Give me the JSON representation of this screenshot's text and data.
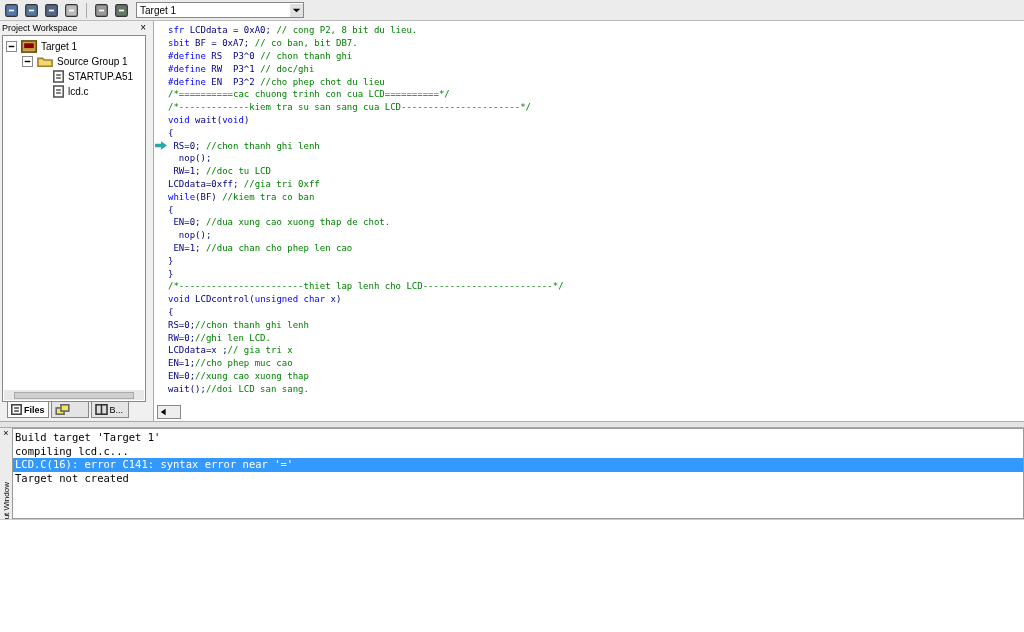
{
  "toolbar": {
    "target": "Target 1"
  },
  "workspace": {
    "title": "Project Workspace",
    "close": "×",
    "tree": [
      {
        "label": "Target 1",
        "kind": "target",
        "expanded": true,
        "children": [
          {
            "label": "Source Group 1",
            "kind": "folder",
            "expanded": true,
            "children": [
              {
                "label": "STARTUP.A51",
                "kind": "file"
              },
              {
                "label": "lcd.c",
                "kind": "file"
              }
            ]
          }
        ]
      }
    ],
    "tabs": [
      {
        "label": "Files",
        "kind": "files",
        "selected": true
      },
      {
        "kind": "regs",
        "selected": false
      },
      {
        "label": "B...",
        "kind": "books",
        "selected": false
      }
    ]
  },
  "editor": {
    "lines": [
      {
        "segs": [
          {
            "kind": "kw",
            "text": "sfr"
          },
          {
            "kind": "code",
            "text": " LCDdata = 0xA0; "
          },
          {
            "kind": "comment",
            "text": "// cong P2, 8 bit du lieu."
          }
        ]
      },
      {
        "segs": [
          {
            "kind": "kw",
            "text": "sbit"
          },
          {
            "kind": "code",
            "text": " BF = 0xA7; "
          },
          {
            "kind": "comment",
            "text": "// co ban, bit DB7."
          }
        ]
      },
      {
        "segs": [
          {
            "kind": "kw",
            "text": "#define"
          },
          {
            "kind": "code",
            "text": " RS  P3^0 "
          },
          {
            "kind": "comment",
            "text": "// chon thanh ghi"
          }
        ]
      },
      {
        "segs": [
          {
            "kind": "kw",
            "text": "#define"
          },
          {
            "kind": "code",
            "text": " RW  P3^1 "
          },
          {
            "kind": "comment",
            "text": "// doc/ghi"
          }
        ]
      },
      {
        "segs": [
          {
            "kind": "kw",
            "text": "#define"
          },
          {
            "kind": "code",
            "text": " EN  P3^2 "
          },
          {
            "kind": "comment",
            "text": "//cho phep chot du lieu"
          }
        ]
      },
      {
        "segs": [
          {
            "kind": "comment",
            "text": "/*==========cac chuong trinh con cua LCD==========*/"
          }
        ]
      },
      {
        "segs": [
          {
            "kind": "comment",
            "text": "/*-------------kiem tra su san sang cua LCD----------------------*/"
          }
        ]
      },
      {
        "segs": [
          {
            "kind": "kw",
            "text": "void"
          },
          {
            "kind": "code",
            "text": " wait("
          },
          {
            "kind": "kw",
            "text": "void"
          },
          {
            "kind": "code",
            "text": ")"
          }
        ]
      },
      {
        "segs": [
          {
            "kind": "code",
            "text": "{"
          }
        ]
      },
      {
        "marker": true,
        "segs": [
          {
            "kind": "code",
            "text": " RS=0; "
          },
          {
            "kind": "comment",
            "text": "//chon thanh ghi lenh"
          }
        ]
      },
      {
        "segs": [
          {
            "kind": "code",
            "text": "  nop();"
          }
        ]
      },
      {
        "segs": [
          {
            "kind": "code",
            "text": " RW=1; "
          },
          {
            "kind": "comment",
            "text": "//doc tu LCD"
          }
        ]
      },
      {
        "segs": [
          {
            "kind": "code",
            "text": "LCDdata=0xff; "
          },
          {
            "kind": "comment",
            "text": "//gia tri 0xff"
          }
        ]
      },
      {
        "segs": [
          {
            "kind": "kw",
            "text": "while"
          },
          {
            "kind": "code",
            "text": "(BF) "
          },
          {
            "kind": "comment",
            "text": "//kiem tra co ban"
          }
        ]
      },
      {
        "segs": [
          {
            "kind": "code",
            "text": "{"
          }
        ]
      },
      {
        "segs": [
          {
            "kind": "code",
            "text": " EN=0; "
          },
          {
            "kind": "comment",
            "text": "//dua xung cao xuong thap de chot."
          }
        ]
      },
      {
        "segs": [
          {
            "kind": "code",
            "text": "  nop();"
          }
        ]
      },
      {
        "segs": [
          {
            "kind": "code",
            "text": " EN=1; "
          },
          {
            "kind": "comment",
            "text": "//dua chan cho phep len cao"
          }
        ]
      },
      {
        "segs": [
          {
            "kind": "code",
            "text": "}"
          }
        ]
      },
      {
        "segs": [
          {
            "kind": "code",
            "text": "}"
          }
        ]
      },
      {
        "segs": [
          {
            "kind": "comment",
            "text": "/*-----------------------thiet lap lenh cho LCD------------------------*/"
          }
        ]
      },
      {
        "segs": [
          {
            "kind": "kw",
            "text": "void"
          },
          {
            "kind": "code",
            "text": " LCDcontrol("
          },
          {
            "kind": "kw",
            "text": "unsigned char"
          },
          {
            "kind": "code",
            "text": " x)"
          }
        ]
      },
      {
        "segs": [
          {
            "kind": "code",
            "text": "{"
          }
        ]
      },
      {
        "segs": [
          {
            "kind": "code",
            "text": "RS=0;"
          },
          {
            "kind": "comment",
            "text": "//chon thanh ghi lenh"
          }
        ]
      },
      {
        "segs": [
          {
            "kind": "code",
            "text": "RW=0;"
          },
          {
            "kind": "comment",
            "text": "//ghi len LCD."
          }
        ]
      },
      {
        "segs": [
          {
            "kind": "code",
            "text": "LCDdata=x ;"
          },
          {
            "kind": "comment",
            "text": "// gia tri x"
          }
        ]
      },
      {
        "segs": [
          {
            "kind": "code",
            "text": "EN=1;"
          },
          {
            "kind": "comment",
            "text": "//cho phep muc cao"
          }
        ]
      },
      {
        "segs": [
          {
            "kind": "code",
            "text": "EN=0;"
          },
          {
            "kind": "comment",
            "text": "//xung cao xuong thap"
          }
        ]
      },
      {
        "segs": [
          {
            "kind": "code",
            "text": "wait();"
          },
          {
            "kind": "comment",
            "text": "//doi LCD san sang."
          }
        ]
      }
    ]
  },
  "output": {
    "close": "×",
    "side_label": "ut Window",
    "lines": [
      {
        "text": "Build target 'Target 1'",
        "selected": false
      },
      {
        "text": "compiling lcd.c...",
        "selected": false
      },
      {
        "text": "LCD.C(16): error C141: syntax error near '='",
        "selected": true
      },
      {
        "text": "Target not created",
        "selected": false
      }
    ]
  }
}
